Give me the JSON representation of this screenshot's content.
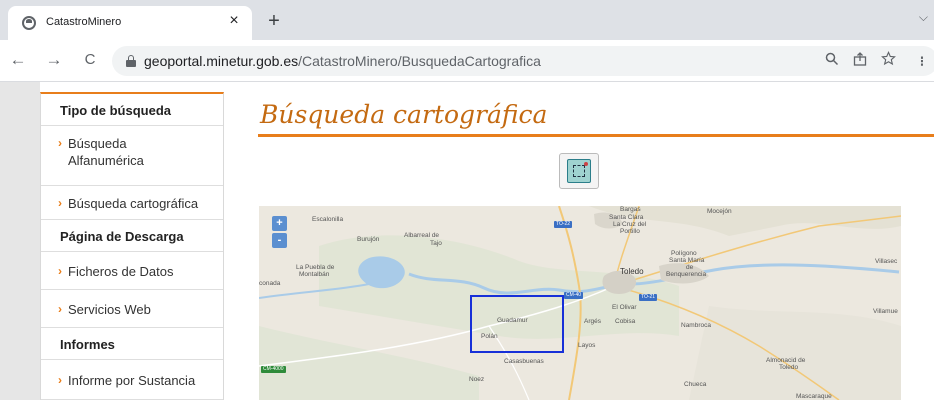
{
  "browser": {
    "tab_title": "CatastroMinero",
    "tab_close": "×",
    "new_tab": "+",
    "tab_list": "⌵",
    "back": "←",
    "forward": "→",
    "reload": "C",
    "url_domain": "geoportal.minetur.gob.es",
    "url_path": "/CatastroMinero/BusquedaCartografica",
    "search_icon": "search-icon",
    "share_icon": "share-icon",
    "star_icon": "star-icon",
    "more_icon": "⁝"
  },
  "sidebar": {
    "heading_search": "Tipo de búsqueda",
    "item_alfa_1": "Búsqueda",
    "item_alfa_2": "Alfanumérica",
    "item_carto": "Búsqueda cartográfica",
    "heading_download": "Página de Descarga",
    "item_ficheros": "Ficheros de Datos",
    "item_servicios": "Servicios Web",
    "heading_informes": "Informes",
    "item_sustancia": "Informe por Sustancia",
    "arrow": "›"
  },
  "main": {
    "title": "Búsqueda cartográfica"
  },
  "map": {
    "zoom_in": "+",
    "zoom_out": "-",
    "labels": {
      "escalonilla": "Escalonilla",
      "burujon": "Burujón",
      "albarreal_1": "Albarreal de",
      "albarreal_2": "Tajo",
      "puebla_1": "La Puebla de",
      "puebla_2": "Montalbán",
      "conada": "conada",
      "toledo": "Toledo",
      "bargas": "Bargas",
      "santa_clara_1": "Santa Clara",
      "santa_clara_2": "La Cruz del",
      "santa_clara_3": "Portillo",
      "mocejon": "Mocejón",
      "poligono_1": "Polígono",
      "poligono_2": "Santa María",
      "poligono_3": "de",
      "poligono_4": "Benquerencia",
      "villaseca": "Villasec",
      "el_olivar": "El Olivar",
      "arges": "Argés",
      "cobisa": "Cobisa",
      "nambroca": "Nambroca",
      "villamue": "Villamue",
      "guadamur": "Guadamur",
      "polan": "Polán",
      "layos": "Layos",
      "casasbuenas": "Casasbuenas",
      "noez": "Noez",
      "almonacid_1": "Almonacid de",
      "almonacid_2": "Toledo",
      "chueca": "Chueca",
      "mascaraque": "Mascaraque"
    },
    "shields": {
      "to22": "TO-22",
      "cm40": "CM-40",
      "to21": "TO-21",
      "cm4000": "CM-4000"
    }
  }
}
